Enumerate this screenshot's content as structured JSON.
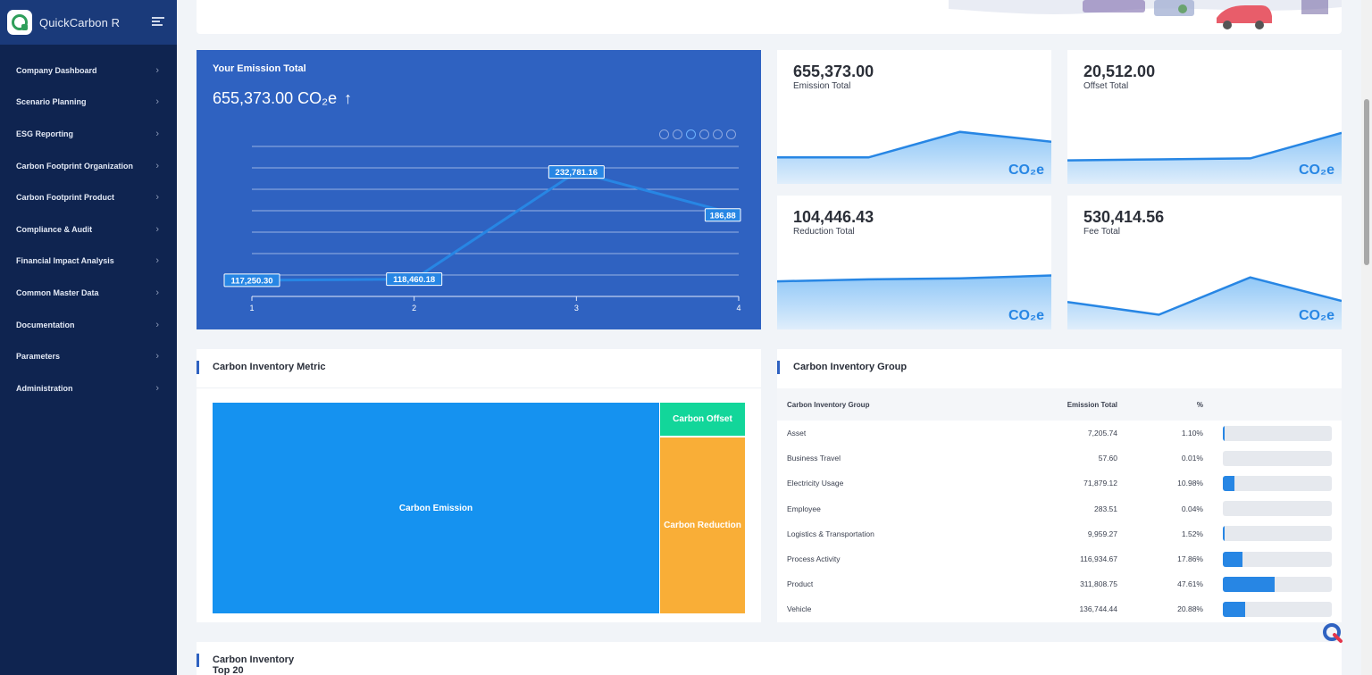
{
  "app": {
    "title": "QuickCarbon R"
  },
  "sidebar": {
    "items": [
      {
        "label": "Company Dashboard"
      },
      {
        "label": "Scenario Planning"
      },
      {
        "label": "ESG Reporting"
      },
      {
        "label": "Carbon Footprint Organization"
      },
      {
        "label": "Carbon Footprint Product"
      },
      {
        "label": "Compliance & Audit"
      },
      {
        "label": "Financial Impact Analysis"
      },
      {
        "label": "Common Master Data"
      },
      {
        "label": "Documentation"
      },
      {
        "label": "Parameters"
      },
      {
        "label": "Administration"
      }
    ]
  },
  "emission_panel": {
    "title": "Your Emission Total",
    "total": "655,373.00 CO₂e",
    "trend_icon": "arrow-up-icon"
  },
  "chart_data": {
    "type": "line",
    "x": [
      1,
      2,
      3,
      4
    ],
    "values": [
      117250.3,
      118460.18,
      232781.16,
      186880
    ],
    "data_labels": [
      "117,250.30",
      "118,460.18",
      "232,781.16",
      "186,88"
    ],
    "tick_labels": [
      "1",
      "2",
      "3",
      "4"
    ],
    "grid": true,
    "color": "#2786e4"
  },
  "stats": [
    {
      "value": "655,373.00",
      "label": "Emission Total",
      "unit": "CO₂e",
      "trend": [
        0.27,
        0.27,
        0.53,
        0.43
      ]
    },
    {
      "value": "20,512.00",
      "label": "Offset Total",
      "unit": "CO₂e",
      "trend": [
        0.24,
        0.25,
        0.26,
        0.52
      ]
    },
    {
      "value": "104,446.43",
      "label": "Reduction Total",
      "unit": "CO₂e",
      "trend": [
        0.49,
        0.51,
        0.52,
        0.55
      ]
    },
    {
      "value": "530,414.56",
      "label": "Fee Total",
      "unit": "CO₂e",
      "trend": [
        0.28,
        0.15,
        0.53,
        0.29
      ]
    }
  ],
  "inventory_metric": {
    "title": "Carbon Inventory Metric",
    "cells": [
      {
        "label": "Carbon Emission",
        "color": "#1592f0"
      },
      {
        "label": "Carbon Offset",
        "color": "#12d69a"
      },
      {
        "label": "Carbon Reduction",
        "color": "#f9ae37"
      }
    ]
  },
  "inventory_group": {
    "title": "Carbon Inventory Group",
    "headers": [
      "Carbon Inventory Group",
      "Emission Total",
      "%"
    ],
    "rows": [
      {
        "name": "Asset",
        "emission": "7,205.74",
        "pct": "1.10%",
        "share": 0.011
      },
      {
        "name": "Business Travel",
        "emission": "57.60",
        "pct": "0.01%",
        "share": 0.0001
      },
      {
        "name": "Electricity Usage",
        "emission": "71,879.12",
        "pct": "10.98%",
        "share": 0.1098
      },
      {
        "name": "Employee",
        "emission": "283.51",
        "pct": "0.04%",
        "share": 0.0004
      },
      {
        "name": "Logistics & Transportation",
        "emission": "9,959.27",
        "pct": "1.52%",
        "share": 0.0152
      },
      {
        "name": "Process Activity",
        "emission": "116,934.67",
        "pct": "17.86%",
        "share": 0.1786
      },
      {
        "name": "Product",
        "emission": "311,808.75",
        "pct": "47.61%",
        "share": 0.4761
      },
      {
        "name": "Vehicle",
        "emission": "136,744.44",
        "pct": "20.88%",
        "share": 0.2088
      }
    ]
  },
  "top20": {
    "title": "Carbon Inventory",
    "subtitle": "Top 20"
  },
  "colors": {
    "sidebar": "#0f2450",
    "panel": "#2f62c1",
    "accent": "#2786e4"
  }
}
